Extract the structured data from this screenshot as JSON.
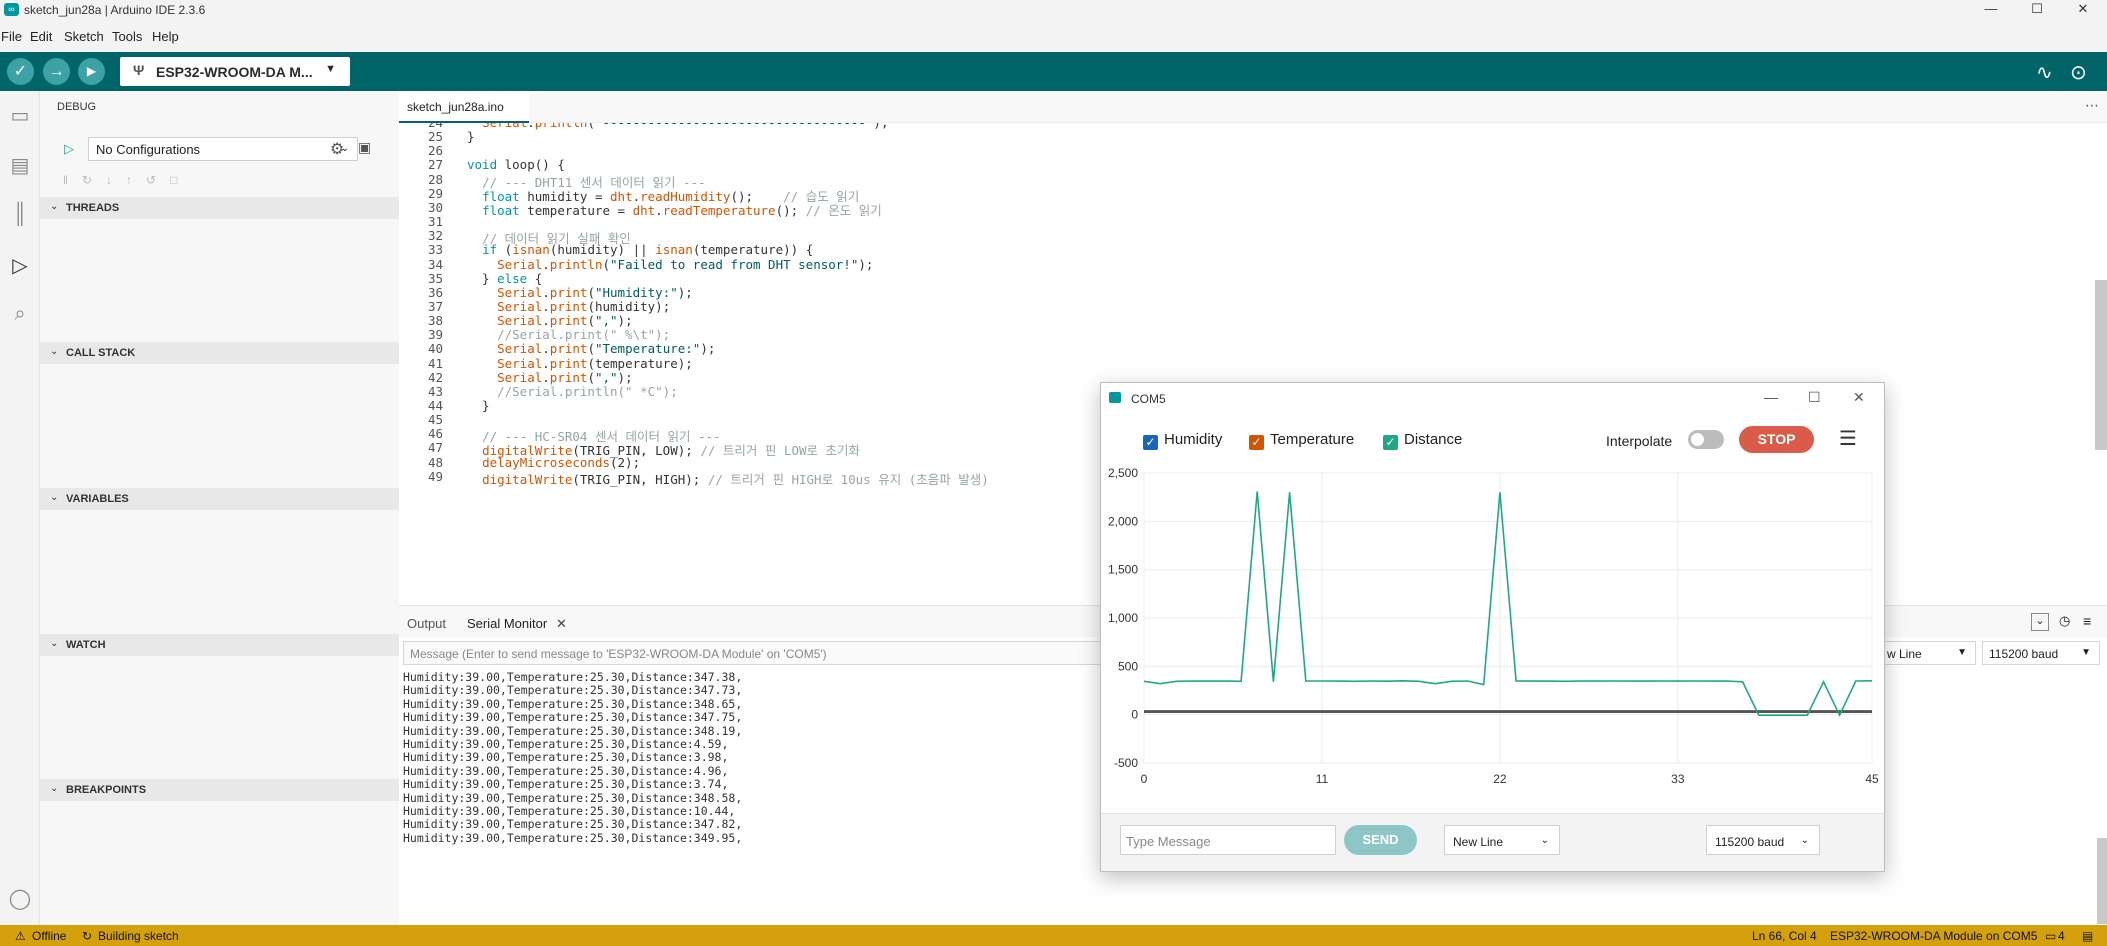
{
  "window": {
    "title": "sketch_jun28a | Arduino IDE 2.3.6",
    "app_icon": "∞",
    "min": "—",
    "max": "☐",
    "close": "✕"
  },
  "menu": [
    "File",
    "Edit",
    "Sketch",
    "Tools",
    "Help"
  ],
  "toolbar": {
    "board": "ESP32-WROOM-DA M...",
    "verify": "✓",
    "upload": "→",
    "debug": "▶"
  },
  "debug": {
    "title": "DEBUG",
    "config": "No Configurations",
    "sections": [
      "THREADS",
      "CALL STACK",
      "VARIABLES",
      "WATCH",
      "BREAKPOINTS"
    ]
  },
  "editor": {
    "tab": "sketch_jun28a.ino",
    "lines": [
      {
        "n": "24",
        "t": "  Serial.println(\"-----------------------------------\");"
      },
      {
        "n": "25",
        "t": "}"
      },
      {
        "n": "26",
        "t": ""
      },
      {
        "n": "27",
        "t": "void loop() {"
      },
      {
        "n": "28",
        "t": "  // --- DHT11 센서 데이터 읽기 ---"
      },
      {
        "n": "29",
        "t": "  float humidity = dht.readHumidity();    // 습도 읽기"
      },
      {
        "n": "30",
        "t": "  float temperature = dht.readTemperature(); // 온도 읽기"
      },
      {
        "n": "31",
        "t": ""
      },
      {
        "n": "32",
        "t": "  // 데이터 읽기 실패 확인"
      },
      {
        "n": "33",
        "t": "  if (isnan(humidity) || isnan(temperature)) {"
      },
      {
        "n": "34",
        "t": "    Serial.println(\"Failed to read from DHT sensor!\");"
      },
      {
        "n": "35",
        "t": "  } else {"
      },
      {
        "n": "36",
        "t": "    Serial.print(\"Humidity:\");"
      },
      {
        "n": "37",
        "t": "    Serial.print(humidity);"
      },
      {
        "n": "38",
        "t": "    Serial.print(\",\");"
      },
      {
        "n": "39",
        "t": "    //Serial.print(\" %\\t\");"
      },
      {
        "n": "40",
        "t": "    Serial.print(\"Temperature:\");"
      },
      {
        "n": "41",
        "t": "    Serial.print(temperature);"
      },
      {
        "n": "42",
        "t": "    Serial.print(\",\");"
      },
      {
        "n": "43",
        "t": "    //Serial.println(\" *C\");"
      },
      {
        "n": "44",
        "t": "  }"
      },
      {
        "n": "45",
        "t": ""
      },
      {
        "n": "46",
        "t": "  // --- HC-SR04 센서 데이터 읽기 ---"
      },
      {
        "n": "47",
        "t": "  digitalWrite(TRIG_PIN, LOW); // 트리거 핀 LOW로 초기화"
      },
      {
        "n": "48",
        "t": "  delayMicroseconds(2);"
      },
      {
        "n": "49",
        "t": "  digitalWrite(TRIG_PIN, HIGH); // 트리거 핀 HIGH로 10us 유지 (초음파 발생)"
      }
    ]
  },
  "bottom": {
    "output_tab": "Output",
    "serial_tab": "Serial Monitor",
    "close": "✕",
    "input_placeholder": "Message (Enter to send message to 'ESP32-WROOM-DA Module' on 'COM5')",
    "line_ending": "w Line",
    "baud": "115200 baud",
    "serial_lines": [
      "Humidity:39.00,Temperature:25.30,Distance:347.38,",
      "Humidity:39.00,Temperature:25.30,Distance:347.73,",
      "Humidity:39.00,Temperature:25.30,Distance:348.65,",
      "Humidity:39.00,Temperature:25.30,Distance:347.75,",
      "Humidity:39.00,Temperature:25.30,Distance:348.19,",
      "Humidity:39.00,Temperature:25.30,Distance:4.59,",
      "Humidity:39.00,Temperature:25.30,Distance:3.98,",
      "Humidity:39.00,Temperature:25.30,Distance:4.96,",
      "Humidity:39.00,Temperature:25.30,Distance:3.74,",
      "Humidity:39.00,Temperature:25.30,Distance:348.58,",
      "Humidity:39.00,Temperature:25.30,Distance:10.44,",
      "Humidity:39.00,Temperature:25.30,Distance:347.82,",
      "Humidity:39.00,Temperature:25.30,Distance:349.95,"
    ]
  },
  "status": {
    "offline": "Offline",
    "building": "Building sketch",
    "position": "Ln 66, Col 4",
    "board_port": "ESP32-WROOM-DA Module on COM5",
    "notifications": "4"
  },
  "plotter": {
    "title": "COM5",
    "interpolate": "Interpolate",
    "stop": "STOP",
    "type_placeholder": "Type Message",
    "send": "SEND",
    "line_ending": "New Line",
    "baud": "115200 baud",
    "checks": [
      "Humidity",
      "Temperature",
      "Distance"
    ]
  },
  "colors": {
    "accent": "#006468",
    "status": "#d4a10d",
    "humidity": "#1a66b8",
    "temperature": "#d35400",
    "distance": "#1fa788"
  },
  "chart_data": {
    "type": "line",
    "ylim": [
      -500,
      2500
    ],
    "yticks": [
      "2,500",
      "2,000",
      "1,500",
      "1,000",
      "500",
      "0",
      "-500"
    ],
    "ytick_values": [
      2500,
      2000,
      1500,
      1000,
      500,
      0,
      -500
    ],
    "xlim": [
      0,
      45
    ],
    "xticks": [
      "0",
      "11",
      "22",
      "33",
      "45"
    ],
    "xtick_values": [
      0,
      11,
      22,
      33,
      45
    ],
    "grid": true,
    "series": [
      {
        "name": "Humidity",
        "color": "#1a66b8",
        "x": [
          0,
          45
        ],
        "y": [
          39,
          39
        ]
      },
      {
        "name": "Temperature",
        "color": "#d35400",
        "x": [
          0,
          45
        ],
        "y": [
          25.3,
          25.3
        ]
      },
      {
        "name": "Distance",
        "color": "#1fa788",
        "x": [
          0,
          1,
          2,
          3,
          4,
          5,
          6,
          7,
          8,
          9,
          10,
          11,
          12,
          13,
          14,
          15,
          16,
          17,
          18,
          19,
          20,
          21,
          22,
          23,
          24,
          25,
          26,
          27,
          28,
          29,
          30,
          31,
          32,
          33,
          34,
          35,
          36,
          37,
          38,
          39,
          40,
          41,
          42,
          43,
          44,
          45
        ],
        "y": [
          345,
          320,
          345,
          348,
          347,
          347,
          345,
          2310,
          340,
          2300,
          348,
          348,
          347,
          345,
          348,
          346,
          350,
          345,
          320,
          345,
          348,
          310,
          2300,
          348,
          347,
          347,
          345,
          348,
          347,
          348,
          347,
          347,
          348,
          347,
          348,
          347,
          348,
          340,
          -5,
          -5,
          -5,
          -5,
          340,
          -5,
          348,
          350
        ]
      }
    ]
  }
}
